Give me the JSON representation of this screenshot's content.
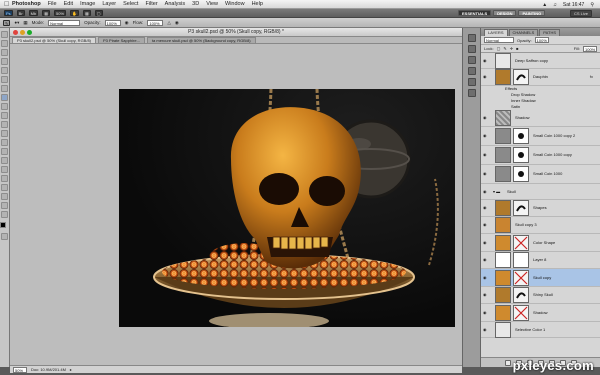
{
  "menubar": {
    "app_name": "Photoshop",
    "items": [
      "File",
      "Edit",
      "Image",
      "Layer",
      "Select",
      "Filter",
      "Analysis",
      "3D",
      "View",
      "Window",
      "Help"
    ],
    "clock": "Sat 16:47"
  },
  "appbar": {
    "logo": "Ps",
    "zoom": "50%",
    "workspaces": [
      "ESSENTIALS",
      "DESIGN",
      "PAINTING"
    ],
    "cs_live": "CS Live"
  },
  "options": {
    "mode_label": "Mode:",
    "mode_value": "Normal",
    "opacity_label": "Opacity:",
    "opacity_value": "100%",
    "flow_label": "Flow:",
    "flow_value": "100%"
  },
  "document": {
    "title": "P3 skull2.psd @ 50% (Skull copy, RGB/8) *",
    "tabs": [
      "P3 skull2.psd @ 50% (Skull copy, RGB/8)",
      "P3 Pirate Sapphire...",
      "ta mercure skull.psd @ 50% (Background copy, RGB/8)"
    ],
    "status_zoom": "50%",
    "status_doc": "Doc: 10.9M/201.4M"
  },
  "layers_panel": {
    "tabs": [
      "LAYERS",
      "CHANNELS",
      "PATHS"
    ],
    "blend_mode": "Normal",
    "opacity_label": "Opacity:",
    "opacity_value": "100%",
    "lock_label": "Lock:",
    "fill_label": "Fill:",
    "fill_value": "100%",
    "layers": [
      {
        "name": "Deep Saffron copy",
        "kind": "adj",
        "selected": false
      },
      {
        "name": "Dauphin",
        "kind": "mask",
        "selected": false,
        "fx": true
      },
      {
        "name": "Effects",
        "kind": "sub",
        "selected": false
      },
      {
        "name": "Drop Shadow",
        "kind": "sub2",
        "selected": false
      },
      {
        "name": "Inner Shadow",
        "kind": "sub2",
        "selected": false
      },
      {
        "name": "Satin",
        "kind": "sub2",
        "selected": false
      },
      {
        "name": "Shadow",
        "kind": "pattern",
        "selected": false
      },
      {
        "name": "Small Coin 1000 copy 2",
        "kind": "coin",
        "selected": false
      },
      {
        "name": "Small Coin 1000 copy",
        "kind": "coin",
        "selected": false
      },
      {
        "name": "Small Coin 1000",
        "kind": "coin",
        "selected": false
      },
      {
        "name": "Skull",
        "kind": "group",
        "selected": false
      },
      {
        "name": "Shapes",
        "kind": "mask",
        "selected": false
      },
      {
        "name": "Skull copy 3",
        "kind": "skull",
        "selected": false
      },
      {
        "name": "Color Shape",
        "kind": "xmask",
        "selected": false
      },
      {
        "name": "Layer 8",
        "kind": "white",
        "selected": false
      },
      {
        "name": "Skull copy",
        "kind": "xmask",
        "selected": true
      },
      {
        "name": "Shiny Skull",
        "kind": "mask",
        "selected": false
      },
      {
        "name": "Shadow",
        "kind": "xmask",
        "selected": false
      },
      {
        "name": "Selective Color 1",
        "kind": "adj",
        "selected": false
      }
    ]
  },
  "watermark": "pxleyes.com",
  "colors": {
    "selection": "#a9c4e6",
    "panel_bg": "#d6d6d6",
    "canvas_bg": "#bdbdbd"
  }
}
